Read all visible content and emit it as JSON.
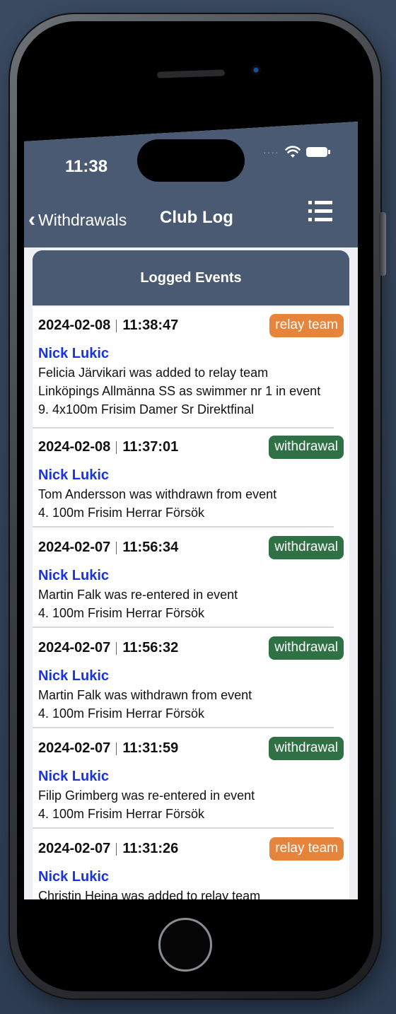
{
  "status": {
    "time": "11:38"
  },
  "nav": {
    "back_label": "Withdrawals",
    "title": "Club Log"
  },
  "section": {
    "title": "Logged Events"
  },
  "entries": [
    {
      "date": "2024-02-08",
      "time": "11:38:47",
      "badge": "relay team",
      "badge_type": "relay",
      "user": "Nick Lukic",
      "lines": [
        "Felicia Järvikari was added to relay team",
        "Linköpings Allmänna SS as swimmer nr 1 in event",
        "9. 4x100m Frisim Damer Sr Direktfinal"
      ]
    },
    {
      "date": "2024-02-08",
      "time": "11:37:01",
      "badge": "withdrawal",
      "badge_type": "withdrawal",
      "user": "Nick Lukic",
      "lines": [
        "Tom Andersson was withdrawn from event",
        "4. 100m Frisim Herrar Försök"
      ]
    },
    {
      "date": "2024-02-07",
      "time": "11:56:34",
      "badge": "withdrawal",
      "badge_type": "withdrawal",
      "user": "Nick Lukic",
      "lines": [
        "Martin Falk was re-entered in event",
        "4. 100m Frisim Herrar Försök"
      ]
    },
    {
      "date": "2024-02-07",
      "time": "11:56:32",
      "badge": "withdrawal",
      "badge_type": "withdrawal",
      "user": "Nick Lukic",
      "lines": [
        "Martin Falk was withdrawn from event",
        "4. 100m Frisim Herrar Försök"
      ]
    },
    {
      "date": "2024-02-07",
      "time": "11:31:59",
      "badge": "withdrawal",
      "badge_type": "withdrawal",
      "user": "Nick Lukic",
      "lines": [
        "Filip Grimberg was re-entered in event",
        "4. 100m Frisim Herrar Försök"
      ]
    },
    {
      "date": "2024-02-07",
      "time": "11:31:26",
      "badge": "relay team",
      "badge_type": "relay",
      "user": "Nick Lukic",
      "lines": [
        "Christin Heina was added to relay team"
      ]
    }
  ],
  "colors": {
    "header": "#4a5a72",
    "relay": "#e6843c",
    "withdrawal": "#2f7045",
    "user": "#1a33e0"
  },
  "icons": {
    "back": "chevron-left-icon",
    "menu": "list-icon",
    "wifi": "wifi-icon",
    "battery": "battery-icon"
  }
}
